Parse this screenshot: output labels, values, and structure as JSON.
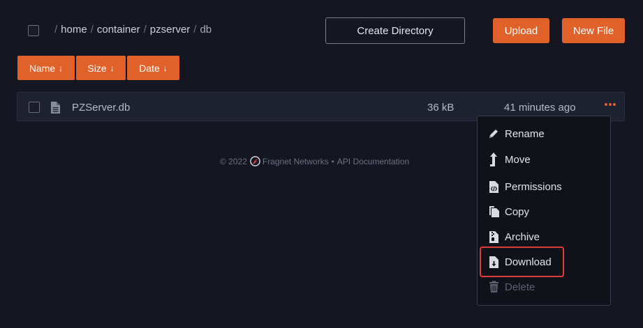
{
  "breadcrumb": {
    "segments": [
      "home",
      "container",
      "pzserver",
      "db"
    ]
  },
  "toolbar": {
    "create_directory_label": "Create Directory",
    "upload_label": "Upload",
    "new_file_label": "New File"
  },
  "sort": {
    "name_label": "Name",
    "size_label": "Size",
    "date_label": "Date",
    "arrow": "↓"
  },
  "files": [
    {
      "name": "PZServer.db",
      "size": "36 kB",
      "modified": "41 minutes ago"
    }
  ],
  "context_menu": {
    "items": [
      {
        "label": "Rename",
        "icon": "pencil-icon"
      },
      {
        "label": "Move",
        "icon": "move-arrow-icon"
      },
      {
        "label": "Permissions",
        "icon": "file-code-icon"
      },
      {
        "label": "Copy",
        "icon": "copy-icon"
      },
      {
        "label": "Archive",
        "icon": "file-archive-icon"
      },
      {
        "label": "Download",
        "icon": "file-download-icon"
      },
      {
        "label": "Delete",
        "icon": "trash-icon"
      }
    ]
  },
  "footer": {
    "copyright": "© 2022",
    "company": "Fragnet Networks",
    "separator": "•",
    "api_link": "API Documentation"
  },
  "colors": {
    "accent": "#e0622a",
    "background": "#141622",
    "highlight_box": "#e23a3a"
  }
}
